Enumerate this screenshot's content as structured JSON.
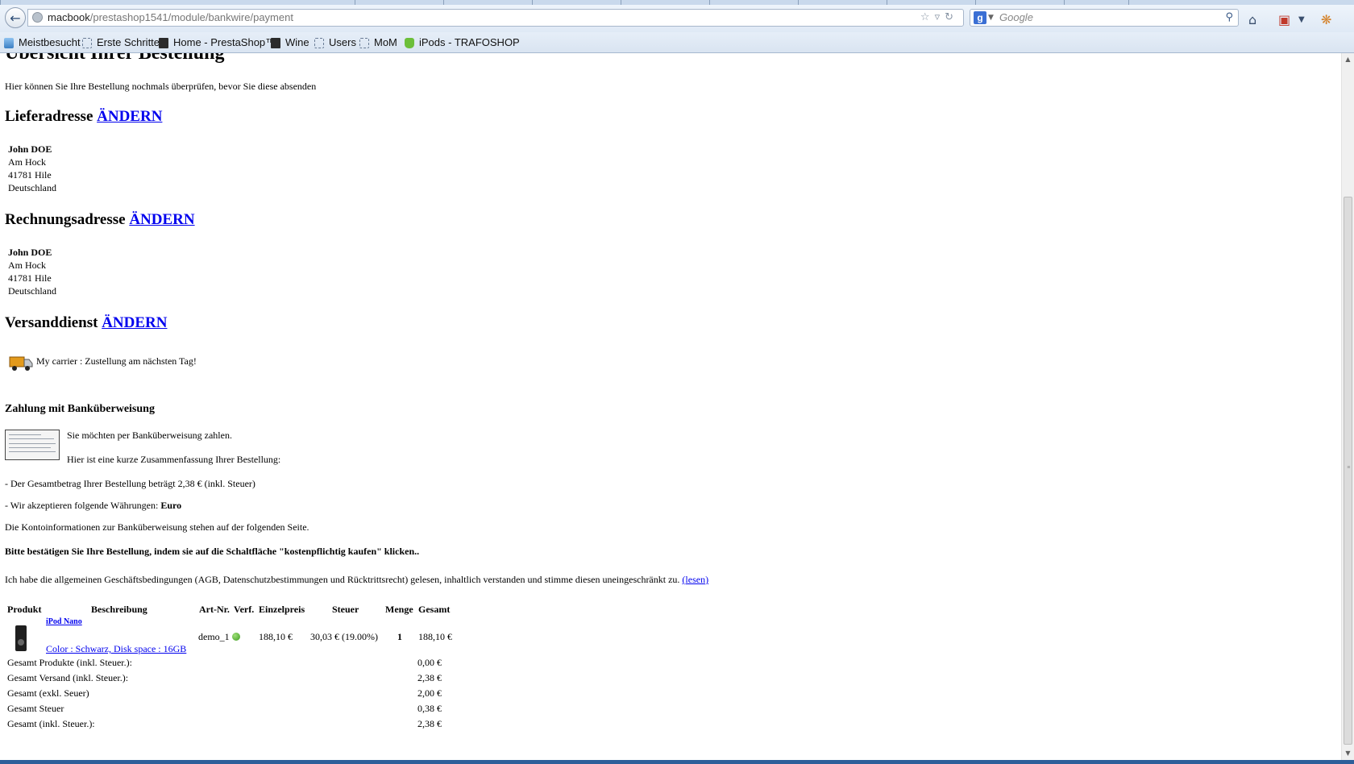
{
  "browser": {
    "url_host": "macbook",
    "url_path": "/prestashop1541/module/bankwire/payment",
    "search_placeholder": "Google",
    "bookmarks": [
      "Meistbesucht",
      "Erste Schritte",
      "Home - PrestaShop™",
      "Wine",
      "Users",
      "MoM",
      "iPods - TRAFOSHOP"
    ]
  },
  "page": {
    "title": "Übersicht Ihrer Bestellung",
    "intro": "Hier können Sie Ihre Bestellung nochmals überprüfen, bevor Sie diese absenden",
    "change_label": "ÄNDERN",
    "delivery": {
      "heading": "Lieferadresse",
      "name": "John DOE",
      "street": "Am Hock",
      "city": "41781 Hile",
      "country": "Deutschland"
    },
    "invoice": {
      "heading": "Rechnungsadresse",
      "name": "John DOE",
      "street": "Am Hock",
      "city": "41781 Hile",
      "country": "Deutschland"
    },
    "shipping": {
      "heading": "Versanddienst",
      "carrier": "My carrier : Zustellung am nächsten Tag!"
    },
    "payment": {
      "heading": "Zahlung mit Banküberweisung",
      "line1": "Sie möchten per Banküberweisung zahlen.",
      "line2": "Hier ist eine kurze Zusammenfassung Ihrer Bestellung:",
      "total_line": "- Der Gesamtbetrag Ihrer Bestellung beträgt 2,38 € (inkl. Steuer)",
      "currency_prefix": "- Wir akzeptieren folgende Währungen:",
      "currency": "Euro",
      "account_info": "Die Kontoinformationen zur Banküberweisung stehen auf der folgenden Seite.",
      "confirm": "Bitte bestätigen Sie Ihre Bestellung, indem sie auf die Schaltfläche \"kostenpflichtig kaufen\" klicken..",
      "terms": "Ich habe die allgemeinen Geschäftsbedingungen (AGB, Datenschutzbestimmungen und Rücktrittsrecht) gelesen, inhaltlich verstanden und stimme diesen uneingeschränkt zu.",
      "terms_link": "(lesen)"
    },
    "cart": {
      "headers": {
        "product": "Produkt",
        "description": "Beschreibung",
        "ref": "Art-Nr.",
        "avail": "Verf.",
        "unit_price": "Einzelpreis",
        "tax": "Steuer",
        "qty": "Menge",
        "total": "Gesamt"
      },
      "item": {
        "name": "iPod Nano",
        "attributes": "Color : Schwarz, Disk space : 16GB",
        "ref": "demo_1",
        "unit_price": "188,10 €",
        "tax": "30,03 € (19.00%)",
        "qty": "1",
        "total": "188,10 €"
      },
      "totals": [
        {
          "label": "Gesamt Produkte (inkl. Steuer.):",
          "value": "0,00 €"
        },
        {
          "label": "Gesamt Versand (inkl. Steuer.):",
          "value": "2,38 €"
        },
        {
          "label": "Gesamt (exkl. Seuer)",
          "value": "2,00 €"
        },
        {
          "label": "Gesamt Steuer",
          "value": "0,38 €"
        },
        {
          "label": "Gesamt (inkl. Steuer.):",
          "value": "2,38 €"
        }
      ]
    }
  }
}
